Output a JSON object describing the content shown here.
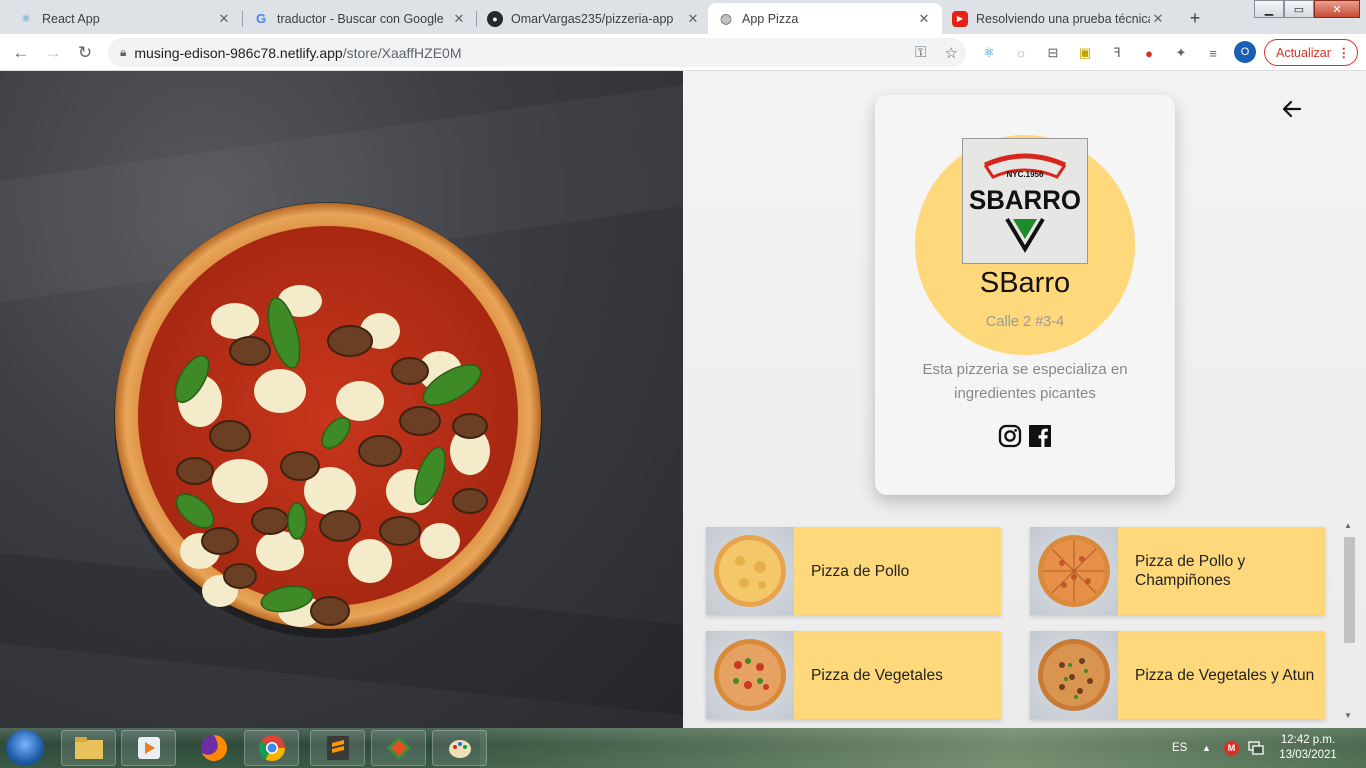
{
  "browser": {
    "tabs": [
      {
        "title": "React App",
        "icon": "react-icon",
        "active": false
      },
      {
        "title": "traductor - Buscar con Google",
        "icon": "google-icon",
        "active": false
      },
      {
        "title": "OmarVargas235/pizzeria-app",
        "icon": "github-icon",
        "active": false
      },
      {
        "title": "App Pizza",
        "icon": "globe-icon",
        "active": true
      },
      {
        "title": "Resolviendo una prueba técnica",
        "icon": "youtube-icon",
        "active": false
      }
    ],
    "url_host": "musing-edison-986c78.netlify.app",
    "url_path": "/store/XaaffHZE0M",
    "profile_initial": "O",
    "update_label": "Actualizar"
  },
  "store": {
    "name": "SBarro",
    "address": "Calle 2 #3-4",
    "description": "Esta pizzeria se especializa en ingredientes picantes",
    "logo": {
      "brand": "SBARRO",
      "tagline": "NYC.1956"
    },
    "social": [
      "instagram-icon",
      "facebook-icon"
    ],
    "accent_color": "#fed87a"
  },
  "products": [
    {
      "name": "Pizza de Pollo"
    },
    {
      "name": "Pizza de Pollo y Champiñones"
    },
    {
      "name": "Pizza de Vegetales"
    },
    {
      "name": "Pizza de Vegetales y Atun"
    }
  ],
  "taskbar": {
    "language": "ES",
    "time": "12:42 p.m.",
    "date": "13/03/2021"
  }
}
